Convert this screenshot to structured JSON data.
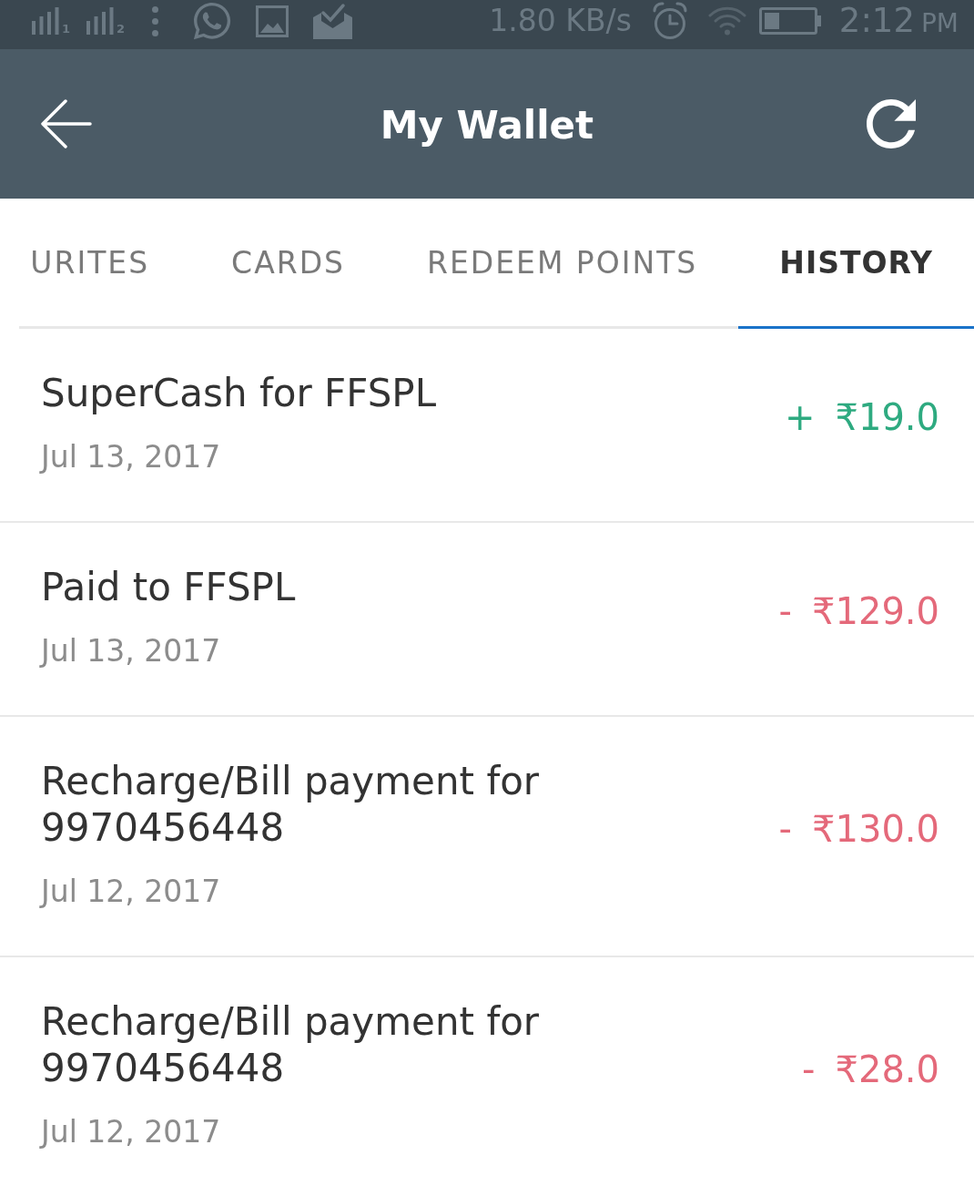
{
  "status_bar": {
    "sims": [
      {
        "label": "1"
      },
      {
        "label": "2"
      }
    ],
    "network_speed": "1.80 KB/s",
    "time": "2:12",
    "meridiem": "PM"
  },
  "header": {
    "title": "My Wallet"
  },
  "tabs": [
    {
      "label": "URITES",
      "selected": false
    },
    {
      "label": "CARDS",
      "selected": false
    },
    {
      "label": "REDEEM POINTS",
      "selected": false
    },
    {
      "label": "HISTORY",
      "selected": true
    }
  ],
  "transactions": [
    {
      "title": "SuperCash for FFSPL",
      "date": "Jul 13, 2017",
      "kind": "credit",
      "sign": "+",
      "amount": "₹19.0"
    },
    {
      "title": "Paid to FFSPL",
      "date": "Jul 13, 2017",
      "kind": "debit",
      "sign": "-",
      "amount": "₹129.0"
    },
    {
      "title": "Recharge/Bill payment for 9970456448",
      "date": "Jul 12, 2017",
      "kind": "debit",
      "sign": "-",
      "amount": "₹130.0"
    },
    {
      "title": "Recharge/Bill payment for 9970456448",
      "date": "Jul 12, 2017",
      "kind": "debit",
      "sign": "-",
      "amount": "₹28.0"
    }
  ]
}
